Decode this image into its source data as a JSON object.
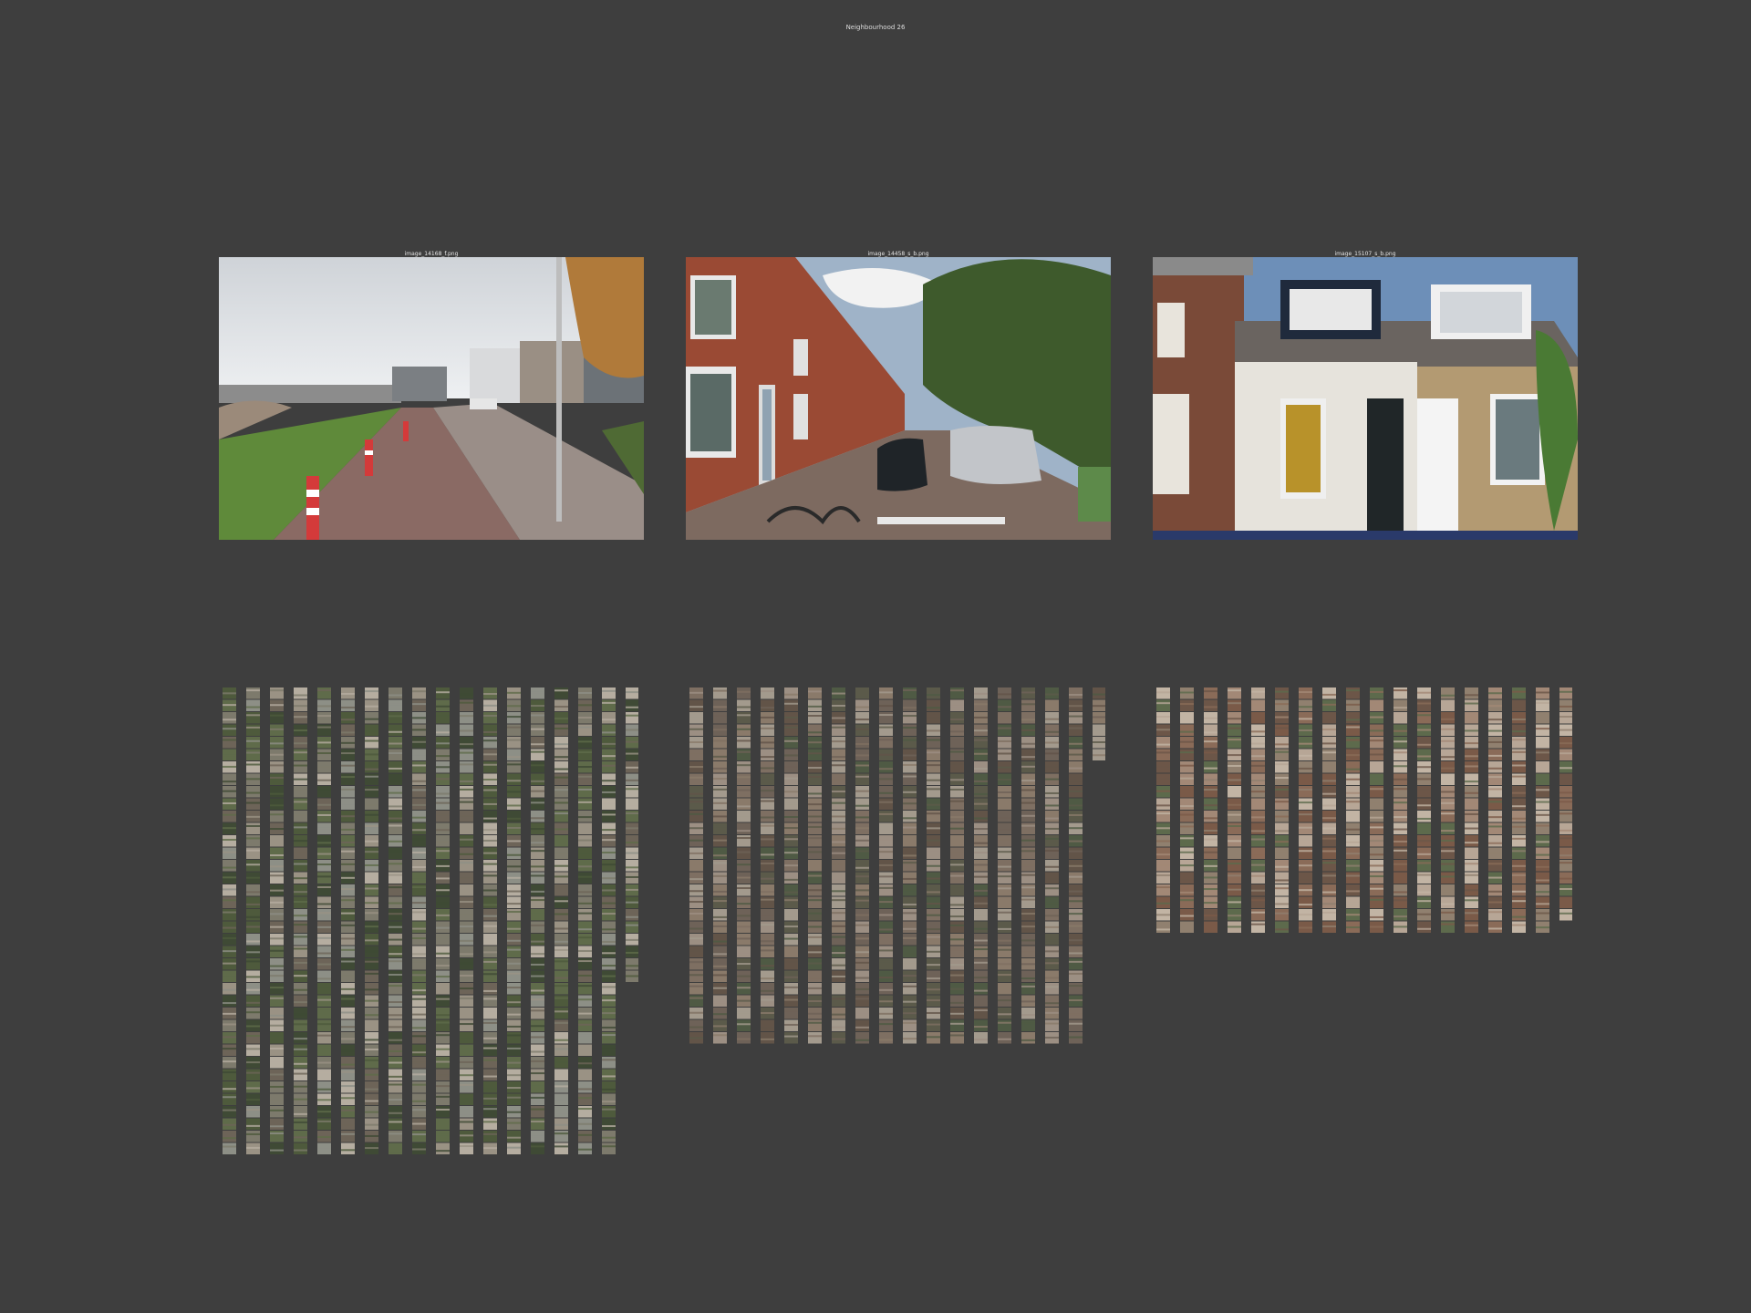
{
  "title": "Neighbourhood 26",
  "panels": [
    {
      "filename": "image_14168_f.png",
      "scene": "street-with-barriers"
    },
    {
      "filename": "image_14458_s_b.png",
      "scene": "residential-street"
    },
    {
      "filename": "image_15107_s_b.png",
      "scene": "house-facade"
    }
  ],
  "thumbnail_grids": [
    {
      "columns": 18,
      "rows": 38,
      "last_column_rows": 24,
      "palette": [
        "#7d7a6c",
        "#5f6b4a",
        "#9a9284",
        "#4e5a3c",
        "#b5ada0",
        "#6d6458",
        "#8d8f86",
        "#3f4a35"
      ]
    },
    {
      "columns": 18,
      "rows": 29,
      "last_column_rows": 6,
      "palette": [
        "#6e6258",
        "#8a7a6a",
        "#5b5a4a",
        "#a39a8d",
        "#4f5a44",
        "#7e6f62",
        "#9c8f83",
        "#625448"
      ]
    },
    {
      "columns": 18,
      "rows": 20,
      "last_column_rows": 19,
      "palette": [
        "#8a6b58",
        "#a28876",
        "#6c5648",
        "#b7a696",
        "#5d6a4c",
        "#90806f",
        "#7a5a48",
        "#c2b4a4"
      ]
    }
  ]
}
